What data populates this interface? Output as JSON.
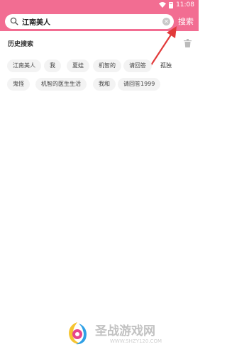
{
  "status_bar": {
    "time": "11:08"
  },
  "search": {
    "value": "江南美人",
    "button_label": "搜索"
  },
  "history": {
    "title": "历史搜索",
    "tags": [
      "江南美人",
      "我",
      "夏娃",
      "机智的",
      "请回答",
      "孤独",
      "鬼怪",
      "机智的医生生活",
      "我和",
      "请回答1999"
    ]
  },
  "watermark": {
    "title": "圣战游戏网",
    "url": "WWW.SHZY120.COM"
  },
  "colors": {
    "accent": "#f26d92",
    "arrow": "#e23a3a",
    "tag_bg": "#f3f3f3"
  }
}
